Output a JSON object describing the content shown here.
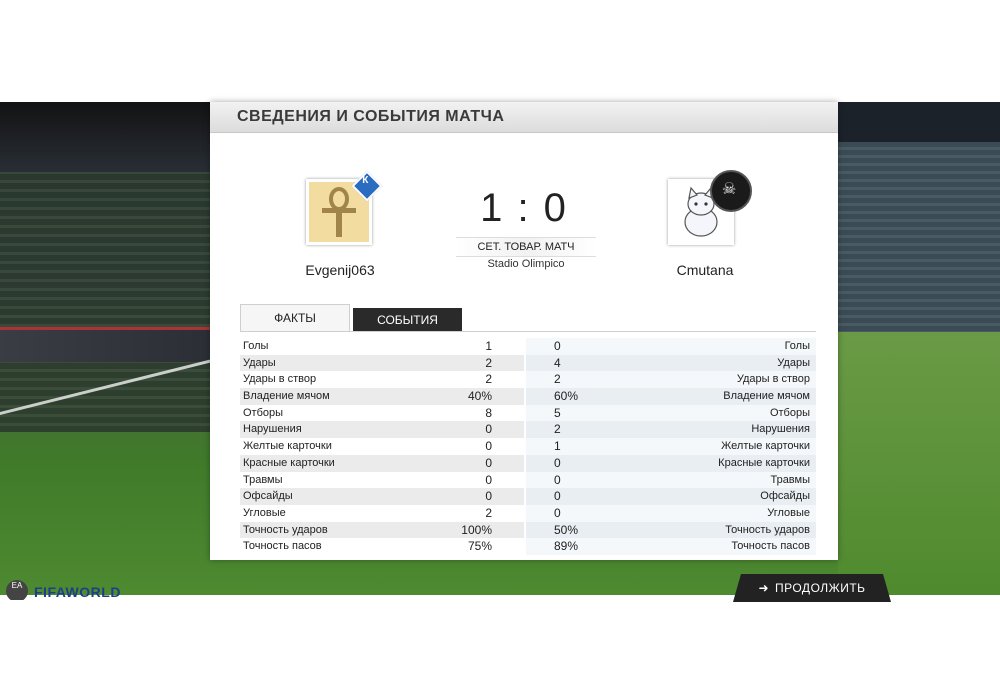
{
  "header": {
    "title": "СВЕДЕНИЯ И СОБЫТИЯ МАТЧА"
  },
  "match": {
    "score": "1 : 0",
    "type": "СЕТ. ТОВАР. МАТЧ",
    "stadium": "Stadio Olimpico",
    "home_team": "Evgenij063",
    "away_team": "Cmutana",
    "home_badge_text": "К",
    "away_badge_icon": "skull-crossbones-icon"
  },
  "tabs": [
    {
      "label": "ФАКТЫ",
      "active": true
    },
    {
      "label": "СОБЫТИЯ",
      "active": false
    }
  ],
  "stats": [
    {
      "label": "Голы",
      "home": "1",
      "away": "0"
    },
    {
      "label": "Удары",
      "home": "2",
      "away": "4"
    },
    {
      "label": "Удары в створ",
      "home": "2",
      "away": "2"
    },
    {
      "label": "Владение мячом",
      "home": "40%",
      "away": "60%"
    },
    {
      "label": "Отборы",
      "home": "8",
      "away": "5"
    },
    {
      "label": "Нарушения",
      "home": "0",
      "away": "2"
    },
    {
      "label": "Желтые карточки",
      "home": "0",
      "away": "1"
    },
    {
      "label": "Красные карточки",
      "home": "0",
      "away": "0"
    },
    {
      "label": "Травмы",
      "home": "0",
      "away": "0"
    },
    {
      "label": "Офсайды",
      "home": "0",
      "away": "0"
    },
    {
      "label": "Угловые",
      "home": "2",
      "away": "0"
    },
    {
      "label": "Точность ударов",
      "home": "100%",
      "away": "50%"
    },
    {
      "label": "Точность пасов",
      "home": "75%",
      "away": "89%"
    }
  ],
  "footer": {
    "continue_label": "ПРОДОЛЖИТЬ",
    "logo_text": "FIFAWORLD",
    "logo_ea": "EA"
  },
  "colors": {
    "accent_blue": "#2a6cc0",
    "dark_button": "#222222",
    "logo_blue": "#1d3f87"
  }
}
